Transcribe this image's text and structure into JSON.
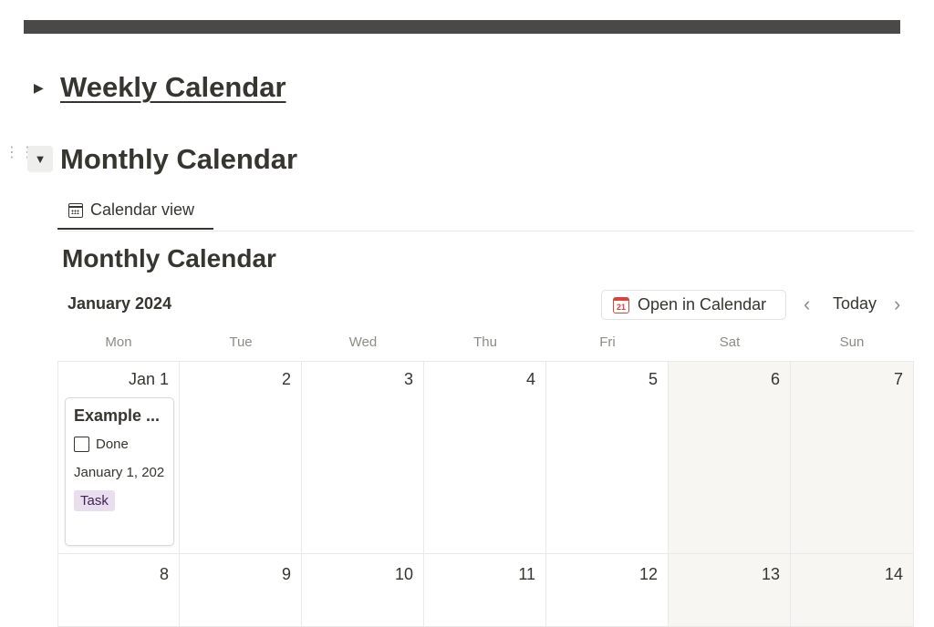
{
  "page": {
    "sections": {
      "weekly": {
        "title": "Weekly Calendar",
        "expanded": false
      },
      "monthly": {
        "title": "Monthly Calendar",
        "expanded": true
      }
    }
  },
  "view_tabs": [
    {
      "label": "Calendar view",
      "icon": "calendar-grid-icon",
      "active": true
    }
  ],
  "database": {
    "title": "Monthly Calendar",
    "month_label": "January 2024",
    "open_in_calendar_label": "Open in Calendar",
    "gcal_icon_text": "21",
    "today_label": "Today",
    "weekdays": [
      "Mon",
      "Tue",
      "Wed",
      "Thu",
      "Fri",
      "Sat",
      "Sun"
    ],
    "weeks": [
      [
        "Jan 1",
        "2",
        "3",
        "4",
        "5",
        "6",
        "7"
      ],
      [
        "8",
        "9",
        "10",
        "11",
        "12",
        "13",
        "14"
      ]
    ],
    "events": [
      {
        "day": "Jan 1",
        "title": "Example ...",
        "checkbox_label": "Done",
        "checked": false,
        "date": "January 1, 202",
        "tag": "Task"
      }
    ]
  },
  "colors": {
    "text": "#37352f",
    "muted": "#8d8b86",
    "weekend_bg": "#f7f6f3",
    "tag_bg": "#e8deee",
    "tag_text": "#412454",
    "gcal_red": "#d9453c",
    "topbar": "#4b4848"
  }
}
